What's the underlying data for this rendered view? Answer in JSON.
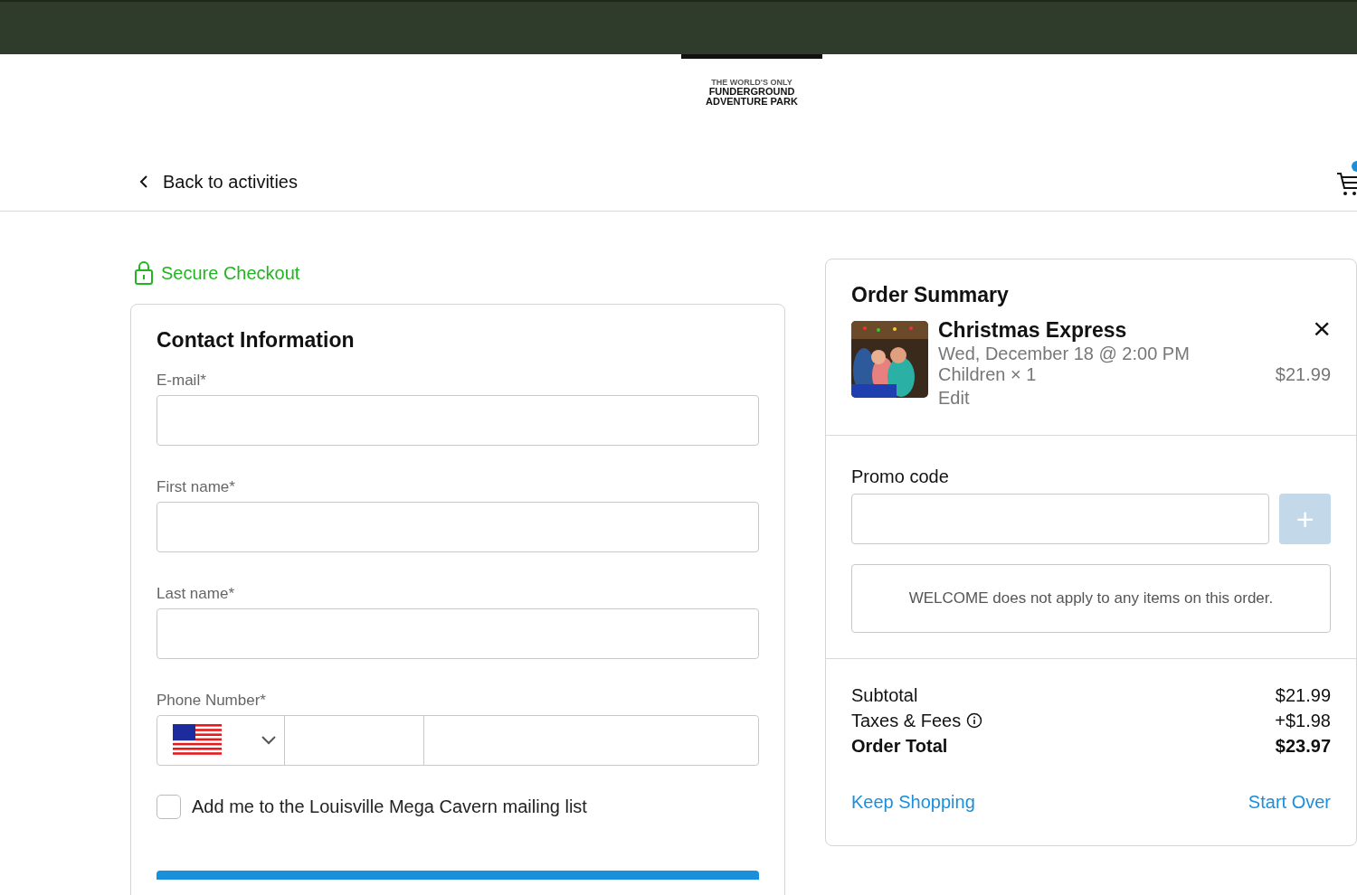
{
  "logo": {
    "tagline": "THE WORLD'S ONLY",
    "line_1": "FUNDERGROUND",
    "line_2": "ADVENTURE PARK"
  },
  "nav": {
    "back_link": "Back to activities"
  },
  "secure_label": "Secure Checkout",
  "contact": {
    "title": "Contact Information",
    "fields": [
      {
        "label": "E-mail*",
        "kind": "text"
      },
      {
        "label": "First name*",
        "kind": "text"
      },
      {
        "label": "Last name*",
        "kind": "text"
      },
      {
        "label": "Phone Number*",
        "kind": "phone"
      }
    ],
    "mailing_list": {
      "label": "Add me to the Louisville Mega Cavern mailing list",
      "checked": false
    }
  },
  "order_summary": {
    "title": "Order Summary",
    "items": [
      {
        "name": "Christmas Express",
        "date": "Wed, December 18 @ 2:00 PM",
        "quantity": "Children × 1",
        "edit": "Edit",
        "price": "$21.99",
        "remove": "×"
      }
    ],
    "promo": {
      "label": "Promo code",
      "button": "+",
      "message": "WELCOME does not apply to any items on this order."
    },
    "totals": [
      {
        "label": "Subtotal",
        "value": "$21.99",
        "kind": "plain",
        "info": false
      },
      {
        "label": "Taxes & Fees",
        "value": "+$1.98",
        "kind": "plain",
        "info": true
      },
      {
        "label": "Order Total",
        "value": "$23.97",
        "kind": "total",
        "info": false
      }
    ],
    "links": [
      "Keep Shopping",
      "Start Over"
    ]
  }
}
